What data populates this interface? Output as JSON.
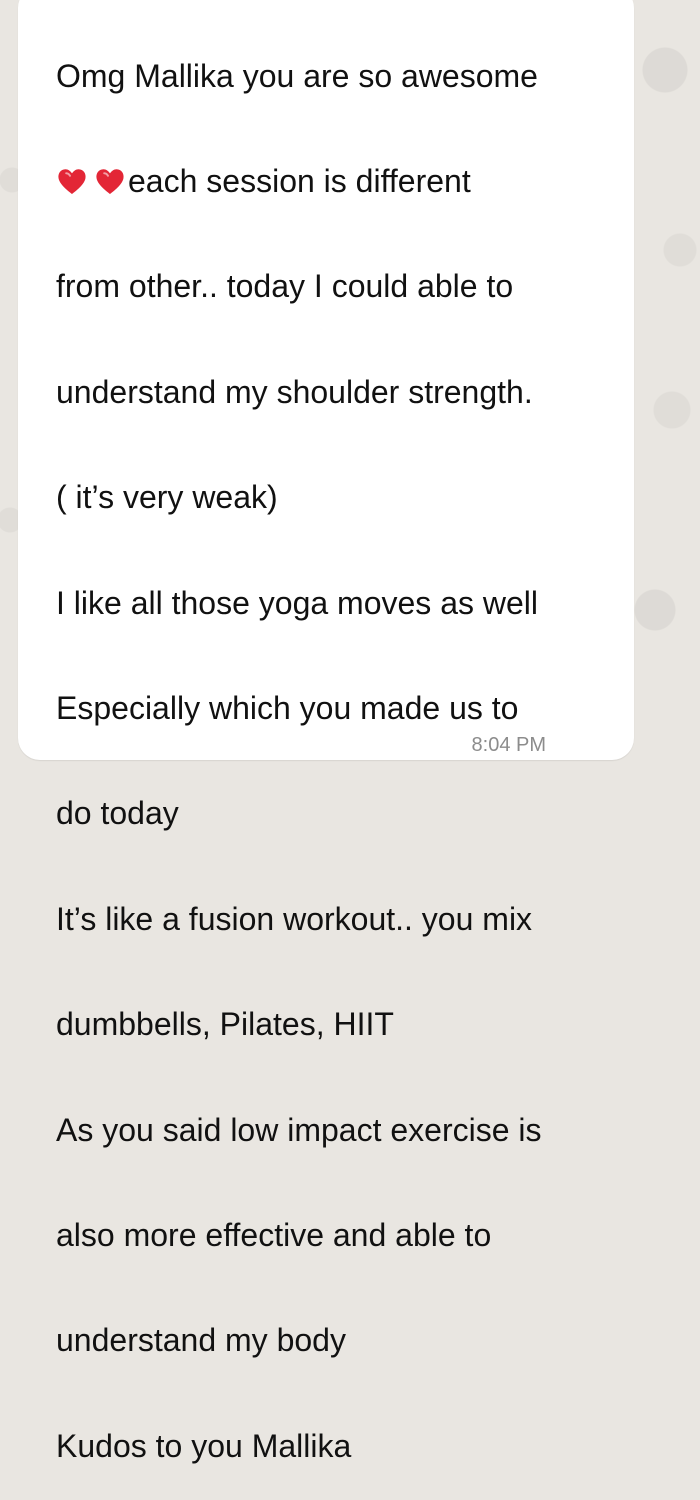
{
  "message": {
    "lines": [
      "Omg Mallika you are so awesome",
      "each session is different",
      "from other.. today I could able to",
      "understand my shoulder strength.",
      "( it’s very weak)",
      "I like all those yoga moves as well",
      "Especially which you made us to",
      "do today",
      "It’s like a fusion workout.. you mix",
      "dumbbells, Pilates,  HIIT",
      "As you said low impact exercise is",
      "also more effective and able to",
      "understand my body",
      "Kudos to you Mallika"
    ],
    "time": "8:04 PM"
  },
  "theme": {
    "background": "#e9e6e1",
    "bubble": "#ffffff",
    "text": "#111111",
    "time": "#8c8c8c",
    "heart": "#e32636"
  },
  "icons": {
    "heart": "red-heart-icon"
  }
}
